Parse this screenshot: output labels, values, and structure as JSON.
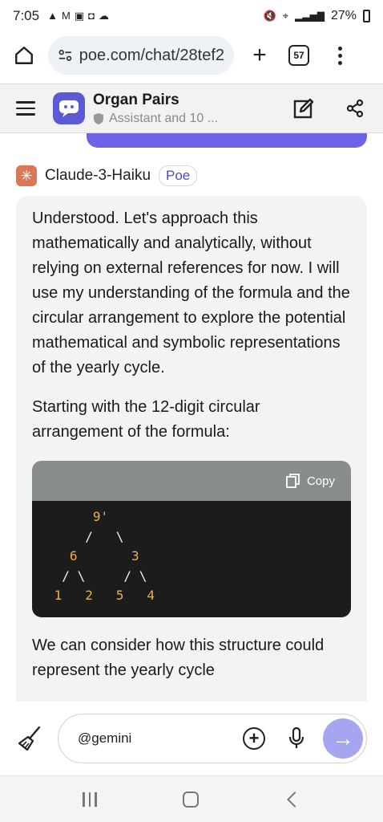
{
  "status_bar": {
    "time": "7:05",
    "left_icons": [
      "navigation-icon",
      "gmail-icon",
      "gallery-icon",
      "bag-icon",
      "cloud-icon"
    ],
    "battery": "27%",
    "right_icons": [
      "mute-icon",
      "location-icon",
      "data-icon",
      "signal-icon",
      "battery-icon"
    ]
  },
  "browser": {
    "url": "poe.com/chat/28tef2",
    "tab_count": "57"
  },
  "chat_header": {
    "title": "Organ Pairs",
    "subtitle": "Assistant and 10 ..."
  },
  "message": {
    "sender": "Claude-3-Haiku",
    "badge": "Poe",
    "paragraph_1": "Understood. Let's approach this mathematically and analytically, without relying on external references for now. I will use my understanding of the formula and the circular arrangement to explore the potential mathematical and symbolic representations of the yearly cycle.",
    "paragraph_2": "Starting with the 12-digit circular arrangement of the formula:",
    "code": {
      "copy_label": "Copy",
      "lines": [
        "      9'",
        "     /   \\",
        "   6       3",
        "  / \\     / \\",
        " 1   2   5   4"
      ]
    },
    "paragraph_3": "We can consider how this structure could represent the yearly cycle"
  },
  "composer": {
    "input_value": "@gemini"
  },
  "colors": {
    "accent": "#6c63e8",
    "send_button": "#a6a6f0",
    "code_digits": "#f0b040"
  }
}
